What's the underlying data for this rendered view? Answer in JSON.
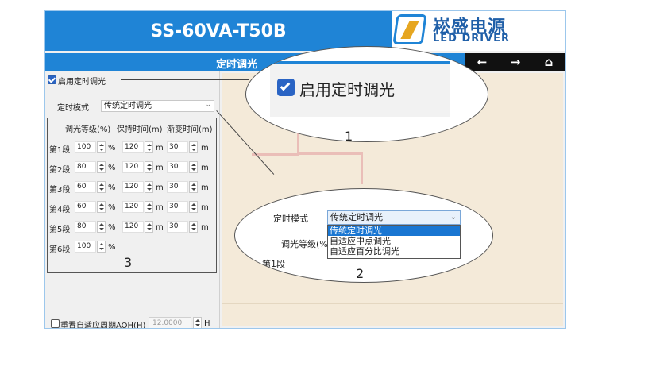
{
  "header": {
    "title": "SS-60VA-T50B"
  },
  "logo": {
    "brand_cn": "崧盛电源",
    "brand_en": "LED DRIVER"
  },
  "subbar": {
    "title": "定时调光"
  },
  "nav": {
    "back": "←",
    "forward": "→",
    "home": "⌂"
  },
  "panel": {
    "enable_label": "启用定时调光",
    "mode_label": "定时模式",
    "mode_value": "传统定时调光",
    "col_headers": [
      "调光等级(%)",
      "保持时间(m)",
      "渐变时间(m)"
    ],
    "rows": [
      {
        "label": "第1段",
        "level": "100",
        "hold": "120",
        "fade": "30"
      },
      {
        "label": "第2段",
        "level": "80",
        "hold": "120",
        "fade": "30"
      },
      {
        "label": "第3段",
        "level": "60",
        "hold": "120",
        "fade": "30"
      },
      {
        "label": "第4段",
        "level": "60",
        "hold": "120",
        "fade": "30"
      },
      {
        "label": "第5段",
        "level": "80",
        "hold": "120",
        "fade": "30"
      },
      {
        "label": "第6段",
        "level": "100",
        "hold": "",
        "fade": ""
      }
    ],
    "unit_pct": "%",
    "unit_min": "m",
    "aoh_label": "重置自适应周期AOH(H)",
    "aoh_value": "12.0000",
    "aoh_unit": "H"
  },
  "callout1": {
    "label": "启用定时调光",
    "number": "1"
  },
  "callout2": {
    "mode_label": "定时模式",
    "selected": "传统定时调光",
    "options": [
      "传统定时调光",
      "自适应中点调光",
      "自适应百分比调光"
    ],
    "partial_header": "调光等级(%",
    "partial_row": "第1段",
    "number": "2"
  },
  "callout3": {
    "number": "3"
  },
  "colors": {
    "accent": "#1f84d6",
    "navbar": "#111111",
    "highlight": "#2a64c4"
  }
}
